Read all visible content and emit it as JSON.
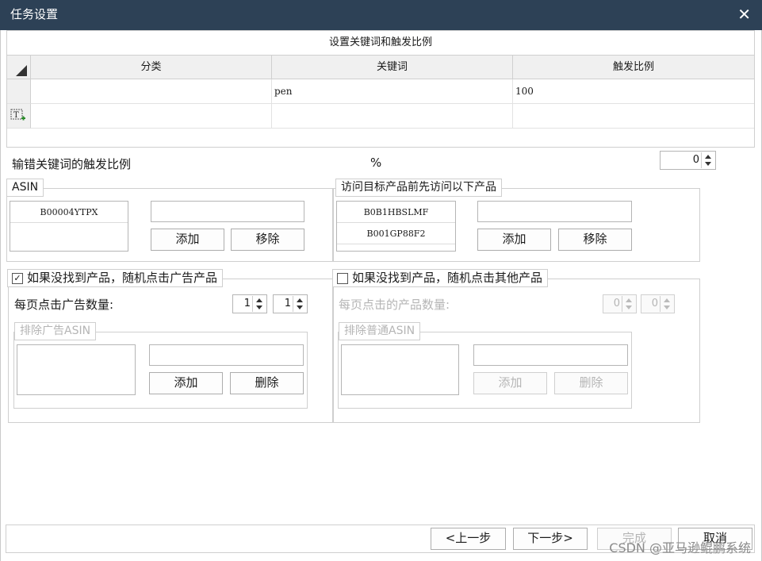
{
  "window": {
    "title": "任务设置",
    "close_icon": "close-icon"
  },
  "keyword_grid": {
    "caption": "设置关键词和触发比例",
    "columns": [
      "分类",
      "关键词",
      "触发比例"
    ],
    "rows": [
      {
        "category": "",
        "keyword": "pen",
        "ratio": "100"
      }
    ]
  },
  "misspell": {
    "label": "输错关键词的触发比例",
    "unit": "%",
    "value": "0"
  },
  "asin_group": {
    "legend": "ASIN",
    "items": [
      "B00004YTPX"
    ],
    "input_value": "",
    "add_label": "添加",
    "remove_label": "移除"
  },
  "pre_visit_group": {
    "legend": "访问目标产品前先访问以下产品",
    "items": [
      "B0B1HBSLMF",
      "B001GP88F2"
    ],
    "input_value": "",
    "add_label": "添加",
    "remove_label": "移除"
  },
  "ad_group": {
    "checkbox_label": "如果没找到产品，随机点击广告产品",
    "checked": true,
    "check_mark": "✓",
    "per_page_label": "每页点击广告数量:",
    "min_value": "1",
    "max_value": "1",
    "exclude": {
      "legend": "排除广告ASIN",
      "input_value": "",
      "add_label": "添加",
      "delete_label": "删除"
    }
  },
  "other_group": {
    "checkbox_label": "如果没找到产品，随机点击其他产品",
    "checked": false,
    "per_page_label": "每页点击的产品数量:",
    "min_value": "0",
    "max_value": "0",
    "exclude": {
      "legend": "排除普通ASIN",
      "input_value": "",
      "add_label": "添加",
      "delete_label": "删除"
    }
  },
  "footer": {
    "prev_label": "<上一步",
    "next_label": "下一步>",
    "finish_label": "完成",
    "cancel_label": "取消"
  },
  "watermark": "CSDN @亚马逊鲲鹏系统",
  "colors": {
    "titlebar": "#2d4156",
    "border": "#cfcfcf",
    "disabled_text": "#b5b5b5"
  }
}
